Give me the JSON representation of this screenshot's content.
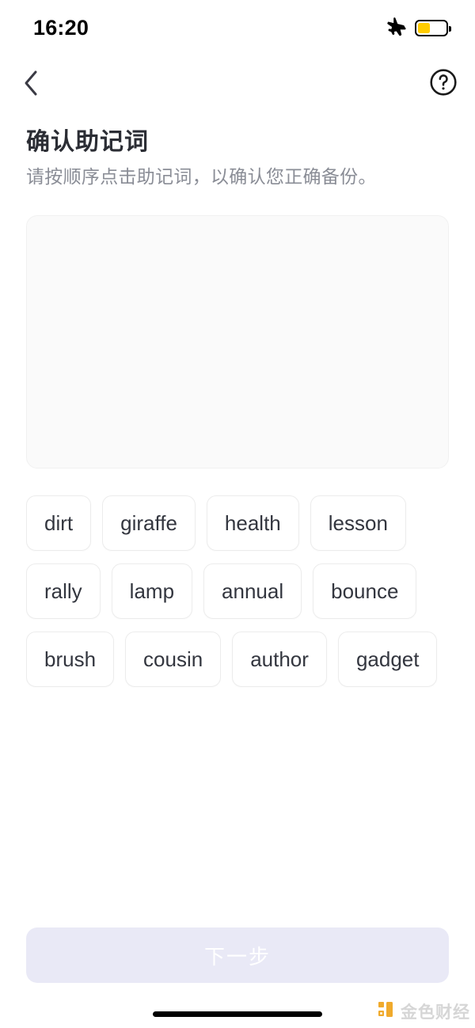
{
  "status_bar": {
    "time": "16:20",
    "airplane_icon": "airplane-mode-icon",
    "battery_icon": "battery-icon",
    "battery_level_percent": 45,
    "battery_color": "#ffcc00"
  },
  "nav_bar": {
    "back_icon": "chevron-left-icon",
    "help_icon": "question-mark-circle-icon"
  },
  "header": {
    "title": "确认助记词",
    "subtitle": "请按顺序点击助记词，以确认您正确备份。"
  },
  "answer_area": {
    "selected_words": [],
    "background_color": "#fafafa"
  },
  "word_bank": {
    "words": [
      "dirt",
      "giraffe",
      "health",
      "lesson",
      "rally",
      "lamp",
      "annual",
      "bounce",
      "brush",
      "cousin",
      "author",
      "gadget"
    ]
  },
  "footer": {
    "next_button_label": "下一步",
    "next_button_enabled": false,
    "next_button_color": "#e9e9f6"
  },
  "watermark": {
    "text": "金色财经",
    "logo_color": "#f0a621"
  }
}
